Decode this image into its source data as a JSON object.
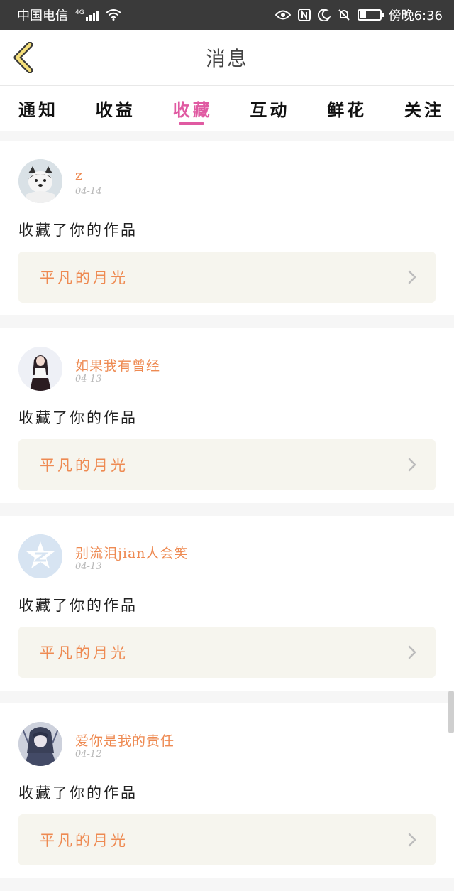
{
  "status_bar": {
    "carrier": "中国电信",
    "network_type": "4G",
    "time": "傍晚6:36",
    "battery_level": 0.3
  },
  "header": {
    "title": "消息"
  },
  "tabs": [
    {
      "label": "通知"
    },
    {
      "label": "收益"
    },
    {
      "label": "收藏"
    },
    {
      "label": "互动"
    },
    {
      "label": "鲜花"
    },
    {
      "label": "关注"
    }
  ],
  "active_tab": "收藏",
  "items": [
    {
      "username": "z",
      "date": "04-14",
      "action": "收藏了你的作品",
      "work_title": "平凡的月光",
      "avatar": "dog-avatar"
    },
    {
      "username": "如果我有曾经",
      "date": "04-13",
      "action": "收藏了你的作品",
      "work_title": "平凡的月光",
      "avatar": "girl-avatar"
    },
    {
      "username": "别流泪jian人会笑",
      "date": "04-13",
      "action": "收藏了你的作品",
      "work_title": "平凡的月光",
      "avatar": "qzone-avatar"
    },
    {
      "username": "爱你是我的责任",
      "date": "04-12",
      "action": "收藏了你的作品",
      "work_title": "平凡的月光",
      "avatar": "anime-avatar"
    }
  ],
  "colors": {
    "accent": "#e05aa2",
    "username": "#ee8a52",
    "status_bar": "#3a3a3a"
  }
}
